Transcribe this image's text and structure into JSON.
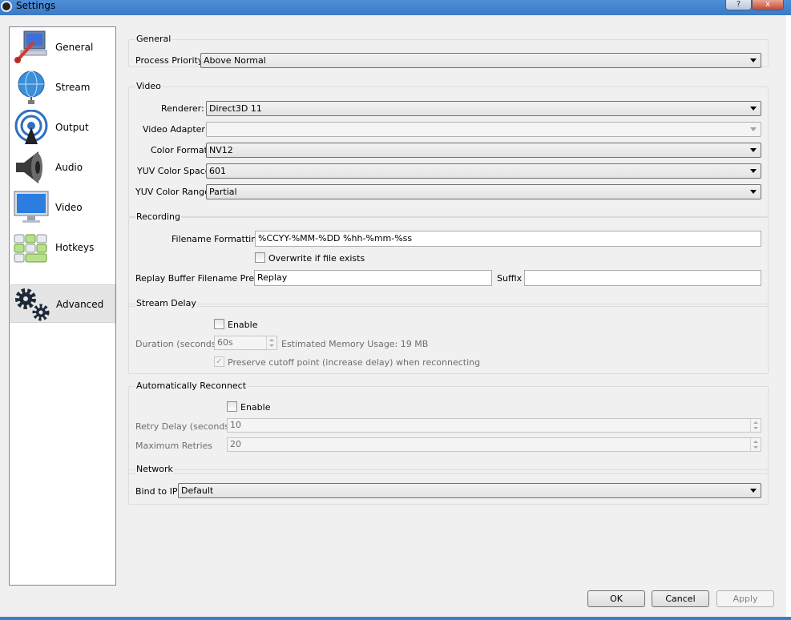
{
  "window": {
    "title": "Settings",
    "help_label": "?",
    "close_label": "x"
  },
  "sidebar": {
    "items": [
      {
        "label": "General",
        "icon": "general-icon"
      },
      {
        "label": "Stream",
        "icon": "stream-globe-icon"
      },
      {
        "label": "Output",
        "icon": "output-broadcast-icon"
      },
      {
        "label": "Audio",
        "icon": "speaker-icon"
      },
      {
        "label": "Video",
        "icon": "monitor-icon"
      },
      {
        "label": "Hotkeys",
        "icon": "keyboard-icon"
      },
      {
        "label": "Advanced",
        "icon": "gears-icon"
      }
    ],
    "selected": "Advanced"
  },
  "general": {
    "title": "General",
    "process_priority_label": "Process Priority",
    "process_priority_value": "Above Normal"
  },
  "video": {
    "title": "Video",
    "renderer_label": "Renderer:",
    "renderer_value": "Direct3D 11",
    "adapter_label": "Video Adapter:",
    "adapter_value": "",
    "color_format_label": "Color Format",
    "color_format_value": "NV12",
    "yuv_space_label": "YUV Color Space",
    "yuv_space_value": "601",
    "yuv_range_label": "YUV Color Range",
    "yuv_range_value": "Partial"
  },
  "recording": {
    "title": "Recording",
    "filename_label": "Filename Formatting",
    "filename_value": "%CCYY-%MM-%DD %hh-%mm-%ss",
    "overwrite_label": "Overwrite if file exists",
    "replay_prefix_label": "Replay Buffer Filename Prefix",
    "replay_prefix_value": "Replay",
    "suffix_label": "Suffix",
    "suffix_value": ""
  },
  "stream_delay": {
    "title": "Stream Delay",
    "enable_label": "Enable",
    "duration_label": "Duration (seconds)",
    "duration_value": "60s",
    "memory_label": "Estimated Memory Usage: 19 MB",
    "preserve_label": "Preserve cutoff point (increase delay) when reconnecting"
  },
  "auto_reconnect": {
    "title": "Automatically Reconnect",
    "enable_label": "Enable",
    "retry_delay_label": "Retry Delay (seconds)",
    "retry_delay_value": "10",
    "max_retries_label": "Maximum Retries",
    "max_retries_value": "20"
  },
  "network": {
    "title": "Network",
    "bind_label": "Bind to IP",
    "bind_value": "Default"
  },
  "buttons": {
    "ok": "OK",
    "cancel": "Cancel",
    "apply": "Apply"
  },
  "colors": {
    "titlebar": "#3a79c6",
    "window_bg": "#f0f0f0",
    "selected_item": "#e5e5e5"
  }
}
